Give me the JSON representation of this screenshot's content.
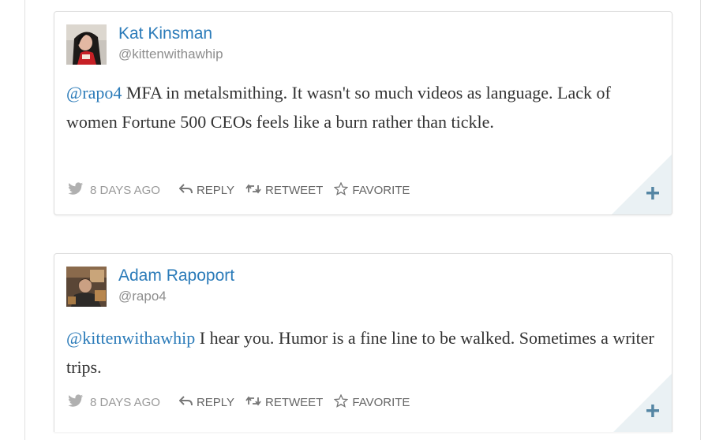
{
  "colors": {
    "link": "#2b7bb9",
    "handle": "#8e8e8e",
    "body_text": "#333333",
    "action": "#666666",
    "corner_fill": "#eaf1f4",
    "plus": "#5586a4"
  },
  "tweets": [
    {
      "display_name": "Kat Kinsman",
      "handle": "@kittenwithawhip",
      "mention": "@rapo4",
      "text": " MFA in metalsmithing. It wasn't so much videos as language. Lack of women Fortune 500 CEOs feels like a burn rather than tickle.",
      "timestamp": "8 DAYS AGO",
      "reply_label": "REPLY",
      "retweet_label": "RETWEET",
      "favorite_label": "FAVORITE",
      "icons": [
        "bird-icon",
        "reply-icon",
        "retweet-icon",
        "star-icon",
        "plus-icon"
      ]
    },
    {
      "display_name": "Adam Rapoport",
      "handle": "@rapo4",
      "mention": "@kittenwithawhip",
      "text": " I hear you. Humor is a fine line to be walked. Sometimes a writer trips.",
      "timestamp": "8 DAYS AGO",
      "reply_label": "REPLY",
      "retweet_label": "RETWEET",
      "favorite_label": "FAVORITE",
      "icons": [
        "bird-icon",
        "reply-icon",
        "retweet-icon",
        "star-icon",
        "plus-icon"
      ]
    }
  ]
}
